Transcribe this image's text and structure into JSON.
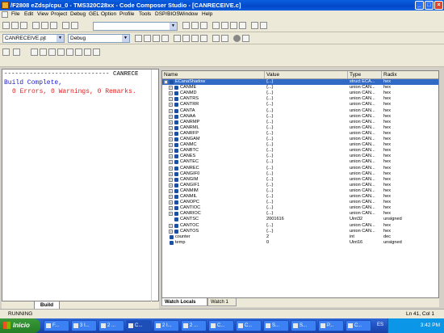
{
  "window": {
    "title": "/F2808 eZdsp/cpu_0 - TMS320C28xx - Code Composer Studio - [CANRECEIVE.c]"
  },
  "menu": [
    "File",
    "Edit",
    "View",
    "Project",
    "Debug",
    "GEL",
    "Option",
    "Profile",
    "Tools",
    "DSP/BIOS",
    "Window",
    "Help"
  ],
  "toolbar": {
    "project_select": "CANRECEIVE.pjt",
    "config_select": "Debug"
  },
  "build_pane": {
    "separator_line": "----------------------------- CANRECE",
    "line1": "Build Complete,",
    "line2": "0 Errors, 0 Warnings, 0 Remarks.",
    "tab_label": "Build"
  },
  "watch": {
    "columns": [
      "Name",
      "Value",
      "Type",
      "Radix"
    ],
    "rows": [
      {
        "name": "ECanaShadow",
        "value": "{...}",
        "type": "struct ECA...",
        "radix": "hex",
        "expander": "−",
        "selected": true,
        "indent": 0
      },
      {
        "name": "CANME",
        "value": "{...}",
        "type": "union CAN...",
        "radix": "hex",
        "expander": "+",
        "indent": 1
      },
      {
        "name": "CANMD",
        "value": "{...}",
        "type": "union CAN...",
        "radix": "hex",
        "expander": "+",
        "indent": 1
      },
      {
        "name": "CANTRS",
        "value": "{...}",
        "type": "union CAN...",
        "radix": "hex",
        "expander": "+",
        "indent": 1
      },
      {
        "name": "CANTRR",
        "value": "{...}",
        "type": "union CAN...",
        "radix": "hex",
        "expander": "+",
        "indent": 1
      },
      {
        "name": "CANTA",
        "value": "{...}",
        "type": "union CAN...",
        "radix": "hex",
        "expander": "+",
        "indent": 1
      },
      {
        "name": "CANAA",
        "value": "{...}",
        "type": "union CAN...",
        "radix": "hex",
        "expander": "+",
        "indent": 1
      },
      {
        "name": "CANRMP",
        "value": "{...}",
        "type": "union CAN...",
        "radix": "hex",
        "expander": "+",
        "indent": 1
      },
      {
        "name": "CANRML",
        "value": "{...}",
        "type": "union CAN...",
        "radix": "hex",
        "expander": "+",
        "indent": 1
      },
      {
        "name": "CANRFP",
        "value": "{...}",
        "type": "union CAN...",
        "radix": "hex",
        "expander": "+",
        "indent": 1
      },
      {
        "name": "CANGAM",
        "value": "{...}",
        "type": "union CAN...",
        "radix": "hex",
        "expander": "+",
        "indent": 1
      },
      {
        "name": "CANMC",
        "value": "{...}",
        "type": "union CAN...",
        "radix": "hex",
        "expander": "+",
        "indent": 1
      },
      {
        "name": "CANBTC",
        "value": "{...}",
        "type": "union CAN...",
        "radix": "hex",
        "expander": "+",
        "indent": 1
      },
      {
        "name": "CANES",
        "value": "{...}",
        "type": "union CAN...",
        "radix": "hex",
        "expander": "+",
        "indent": 1
      },
      {
        "name": "CANTEC",
        "value": "{...}",
        "type": "union CAN...",
        "radix": "hex",
        "expander": "+",
        "indent": 1
      },
      {
        "name": "CANREC",
        "value": "{...}",
        "type": "union CAN...",
        "radix": "hex",
        "expander": "+",
        "indent": 1
      },
      {
        "name": "CANGIF0",
        "value": "{...}",
        "type": "union CAN...",
        "radix": "hex",
        "expander": "+",
        "indent": 1
      },
      {
        "name": "CANGIM",
        "value": "{...}",
        "type": "union CAN...",
        "radix": "hex",
        "expander": "+",
        "indent": 1
      },
      {
        "name": "CANGIF1",
        "value": "{...}",
        "type": "union CAN...",
        "radix": "hex",
        "expander": "+",
        "indent": 1
      },
      {
        "name": "CANMIM",
        "value": "{...}",
        "type": "union CAN...",
        "radix": "hex",
        "expander": "+",
        "indent": 1
      },
      {
        "name": "CANMIL",
        "value": "{...}",
        "type": "union CAN...",
        "radix": "hex",
        "expander": "+",
        "indent": 1
      },
      {
        "name": "CANOPC",
        "value": "{...}",
        "type": "union CAN...",
        "radix": "hex",
        "expander": "+",
        "indent": 1
      },
      {
        "name": "CANTIOC",
        "value": "{...}",
        "type": "union CAN...",
        "radix": "hex",
        "expander": "+",
        "indent": 1
      },
      {
        "name": "CANRIOC",
        "value": "{...}",
        "type": "union CAN...",
        "radix": "hex",
        "expander": "+",
        "indent": 1
      },
      {
        "name": "CANTSC",
        "value": "2001616",
        "type": "Uint32",
        "radix": "unsigned",
        "expander": "",
        "indent": 1
      },
      {
        "name": "CANTOC",
        "value": "{...}",
        "type": "union CAN...",
        "radix": "hex",
        "expander": "+",
        "indent": 1
      },
      {
        "name": "CANTOS",
        "value": "{...}",
        "type": "union CAN...",
        "radix": "hex",
        "expander": "+",
        "indent": 1
      },
      {
        "name": "counter",
        "value": "2",
        "type": "int",
        "radix": "dec",
        "expander": "",
        "indent": 0
      },
      {
        "name": "temp",
        "value": "0",
        "type": "Uint16",
        "radix": "unsigned",
        "expander": "",
        "indent": 0
      }
    ],
    "tabs": [
      "Watch Locals",
      "Watch 1"
    ]
  },
  "statusbar": {
    "state": "RUNNING",
    "position": "Ln 41, Col 1"
  },
  "taskbar": {
    "start": "Inicio",
    "tasks": [
      "F...",
      "3 I...",
      "2 ...",
      "C...",
      "2 I...",
      "2 ...",
      "C...",
      "C...",
      "S...",
      "S...",
      "P...",
      "C..."
    ],
    "language": "ES",
    "clock": "3:42 PM"
  },
  "colors": {
    "title_blue": "#0a5fe0",
    "selection": "#316ac5",
    "build_blue": "#2020d0",
    "build_red": "#e02020",
    "taskbar_blue": "#2457c8",
    "start_green": "#2e8b2e"
  }
}
